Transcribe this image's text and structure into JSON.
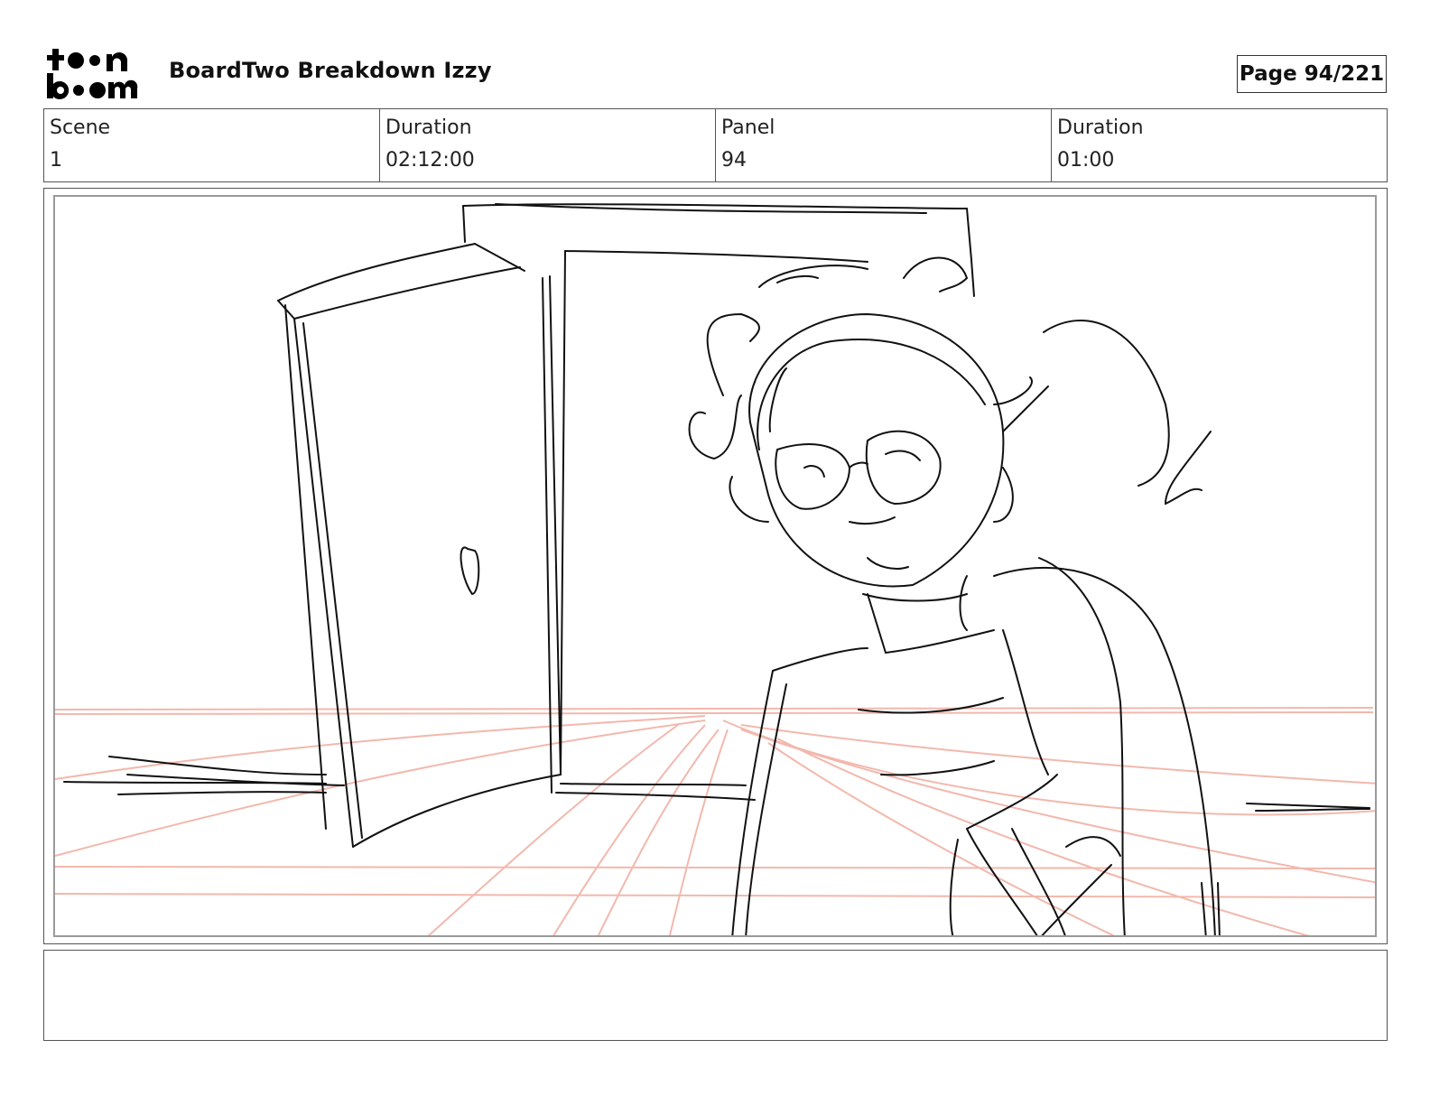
{
  "header": {
    "logo_top": "t••n",
    "logo_bottom": "b••m",
    "title": "BoardTwo Breakdown Izzy",
    "page_label": "Page",
    "page_value": "94/221"
  },
  "info": {
    "scene_label": "Scene",
    "scene_value": "1",
    "scene_duration_label": "Duration",
    "scene_duration_value": "02:12:00",
    "panel_label": "Panel",
    "panel_value": "94",
    "panel_duration_label": "Duration",
    "panel_duration_value": "01:00"
  },
  "panel": {
    "sketch_stroke_color": "#111111",
    "perspective_line_color": "#f2b8ad"
  },
  "notes": {
    "text": ""
  }
}
